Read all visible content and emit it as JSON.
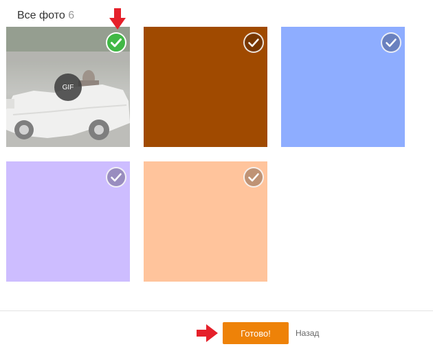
{
  "header": {
    "title": "Все фото",
    "count": "6"
  },
  "photos": [
    {
      "kind": "gif-image",
      "badge": "GIF",
      "selected": true
    },
    {
      "kind": "color",
      "color": "#a04a00",
      "selected": false
    },
    {
      "kind": "color",
      "color": "#8eadff",
      "selected": false
    },
    {
      "kind": "color",
      "color": "#cdbdff",
      "selected": false
    },
    {
      "kind": "color",
      "color": "#ffc49c",
      "selected": false
    }
  ],
  "footer": {
    "done_label": "Готово!",
    "back_label": "Назад"
  },
  "colors": {
    "accent_button": "#ee8208",
    "check_selected": "#41b846",
    "annotation_arrow": "#e5202a"
  },
  "icons": {
    "selection": "checkmark-icon",
    "annotation": "red-arrow-icon"
  }
}
